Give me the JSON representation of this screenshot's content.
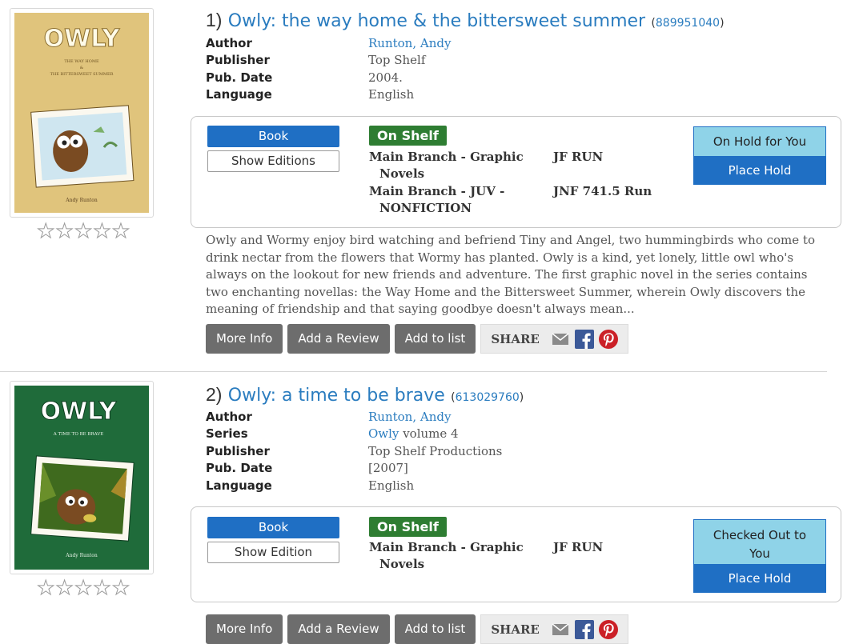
{
  "results": [
    {
      "index": "1)",
      "title": "Owly: the way home & the bittersweet summer",
      "oclc": "889951040",
      "cover": {
        "title_text": "OWLY",
        "subtitle_text": "The Way Home & The Bittersweet Summer",
        "author_text": "Andy Runton",
        "bg_color": "#e0c47c"
      },
      "meta": [
        {
          "label": "Author",
          "value": "Runton, Andy",
          "link": true
        },
        {
          "label": "Publisher",
          "value": "Top Shelf",
          "link": false
        },
        {
          "label": "Pub. Date",
          "value": "2004.",
          "link": false
        },
        {
          "label": "Language",
          "value": "English",
          "link": false
        }
      ],
      "format_label": "Book",
      "editions_label": "Show Editions",
      "availability": "On Shelf",
      "locations": [
        {
          "line1": "Main Branch - Graphic",
          "line2": "Novels",
          "call": "JF RUN"
        },
        {
          "line1": "Main Branch - JUV -",
          "line2": "NONFICTION",
          "call": "JNF 741.5 Run"
        }
      ],
      "hold_status": "On Hold for You",
      "place_hold": "Place Hold",
      "description": "Owly and Wormy enjoy bird watching and befriend Tiny and Angel, two hummingbirds who come to drink nectar from the flowers that Wormy has planted. Owly is a kind, yet lonely, little owl who's always on the lookout for new friends and adventure. The first graphic novel in the series contains two enchanting novellas: the Way Home and the Bittersweet Summer, wherein Owly discovers the meaning of friendship and that saying goodbye doesn't always mean...",
      "actions": {
        "more_info": "More Info",
        "add_review": "Add a Review",
        "add_list": "Add to list",
        "share": "SHARE"
      }
    },
    {
      "index": "2)",
      "title": "Owly: a time to be brave",
      "oclc": "613029760",
      "cover": {
        "title_text": "OWLY",
        "subtitle_text": "A Time To Be Brave",
        "author_text": "Andy Runton",
        "bg_color": "#1f6b3a"
      },
      "meta": [
        {
          "label": "Author",
          "value": "Runton, Andy",
          "link": true
        },
        {
          "label": "Series",
          "value": "Owly",
          "suffix": " volume 4",
          "link": true
        },
        {
          "label": "Publisher",
          "value": "Top Shelf Productions",
          "link": false
        },
        {
          "label": "Pub. Date",
          "value": "[2007]",
          "link": false
        },
        {
          "label": "Language",
          "value": "English",
          "link": false
        }
      ],
      "format_label": "Book",
      "editions_label": "Show Edition",
      "availability": "On Shelf",
      "locations": [
        {
          "line1": "Main Branch - Graphic",
          "line2": "Novels",
          "call": "JF RUN"
        }
      ],
      "hold_status": "Checked Out to You",
      "place_hold": "Place Hold",
      "actions": {
        "more_info": "More Info",
        "add_review": "Add a Review",
        "add_list": "Add to list",
        "share": "SHARE"
      }
    }
  ],
  "colors": {
    "link": "#2a7cbf",
    "primary": "#1f6fc4",
    "on_shelf": "#2e7d32",
    "status_bg": "#8fd3e8",
    "action_btn": "#6d6d6d"
  },
  "icons": [
    "star-icon",
    "email-icon",
    "facebook-icon",
    "pinterest-icon"
  ]
}
